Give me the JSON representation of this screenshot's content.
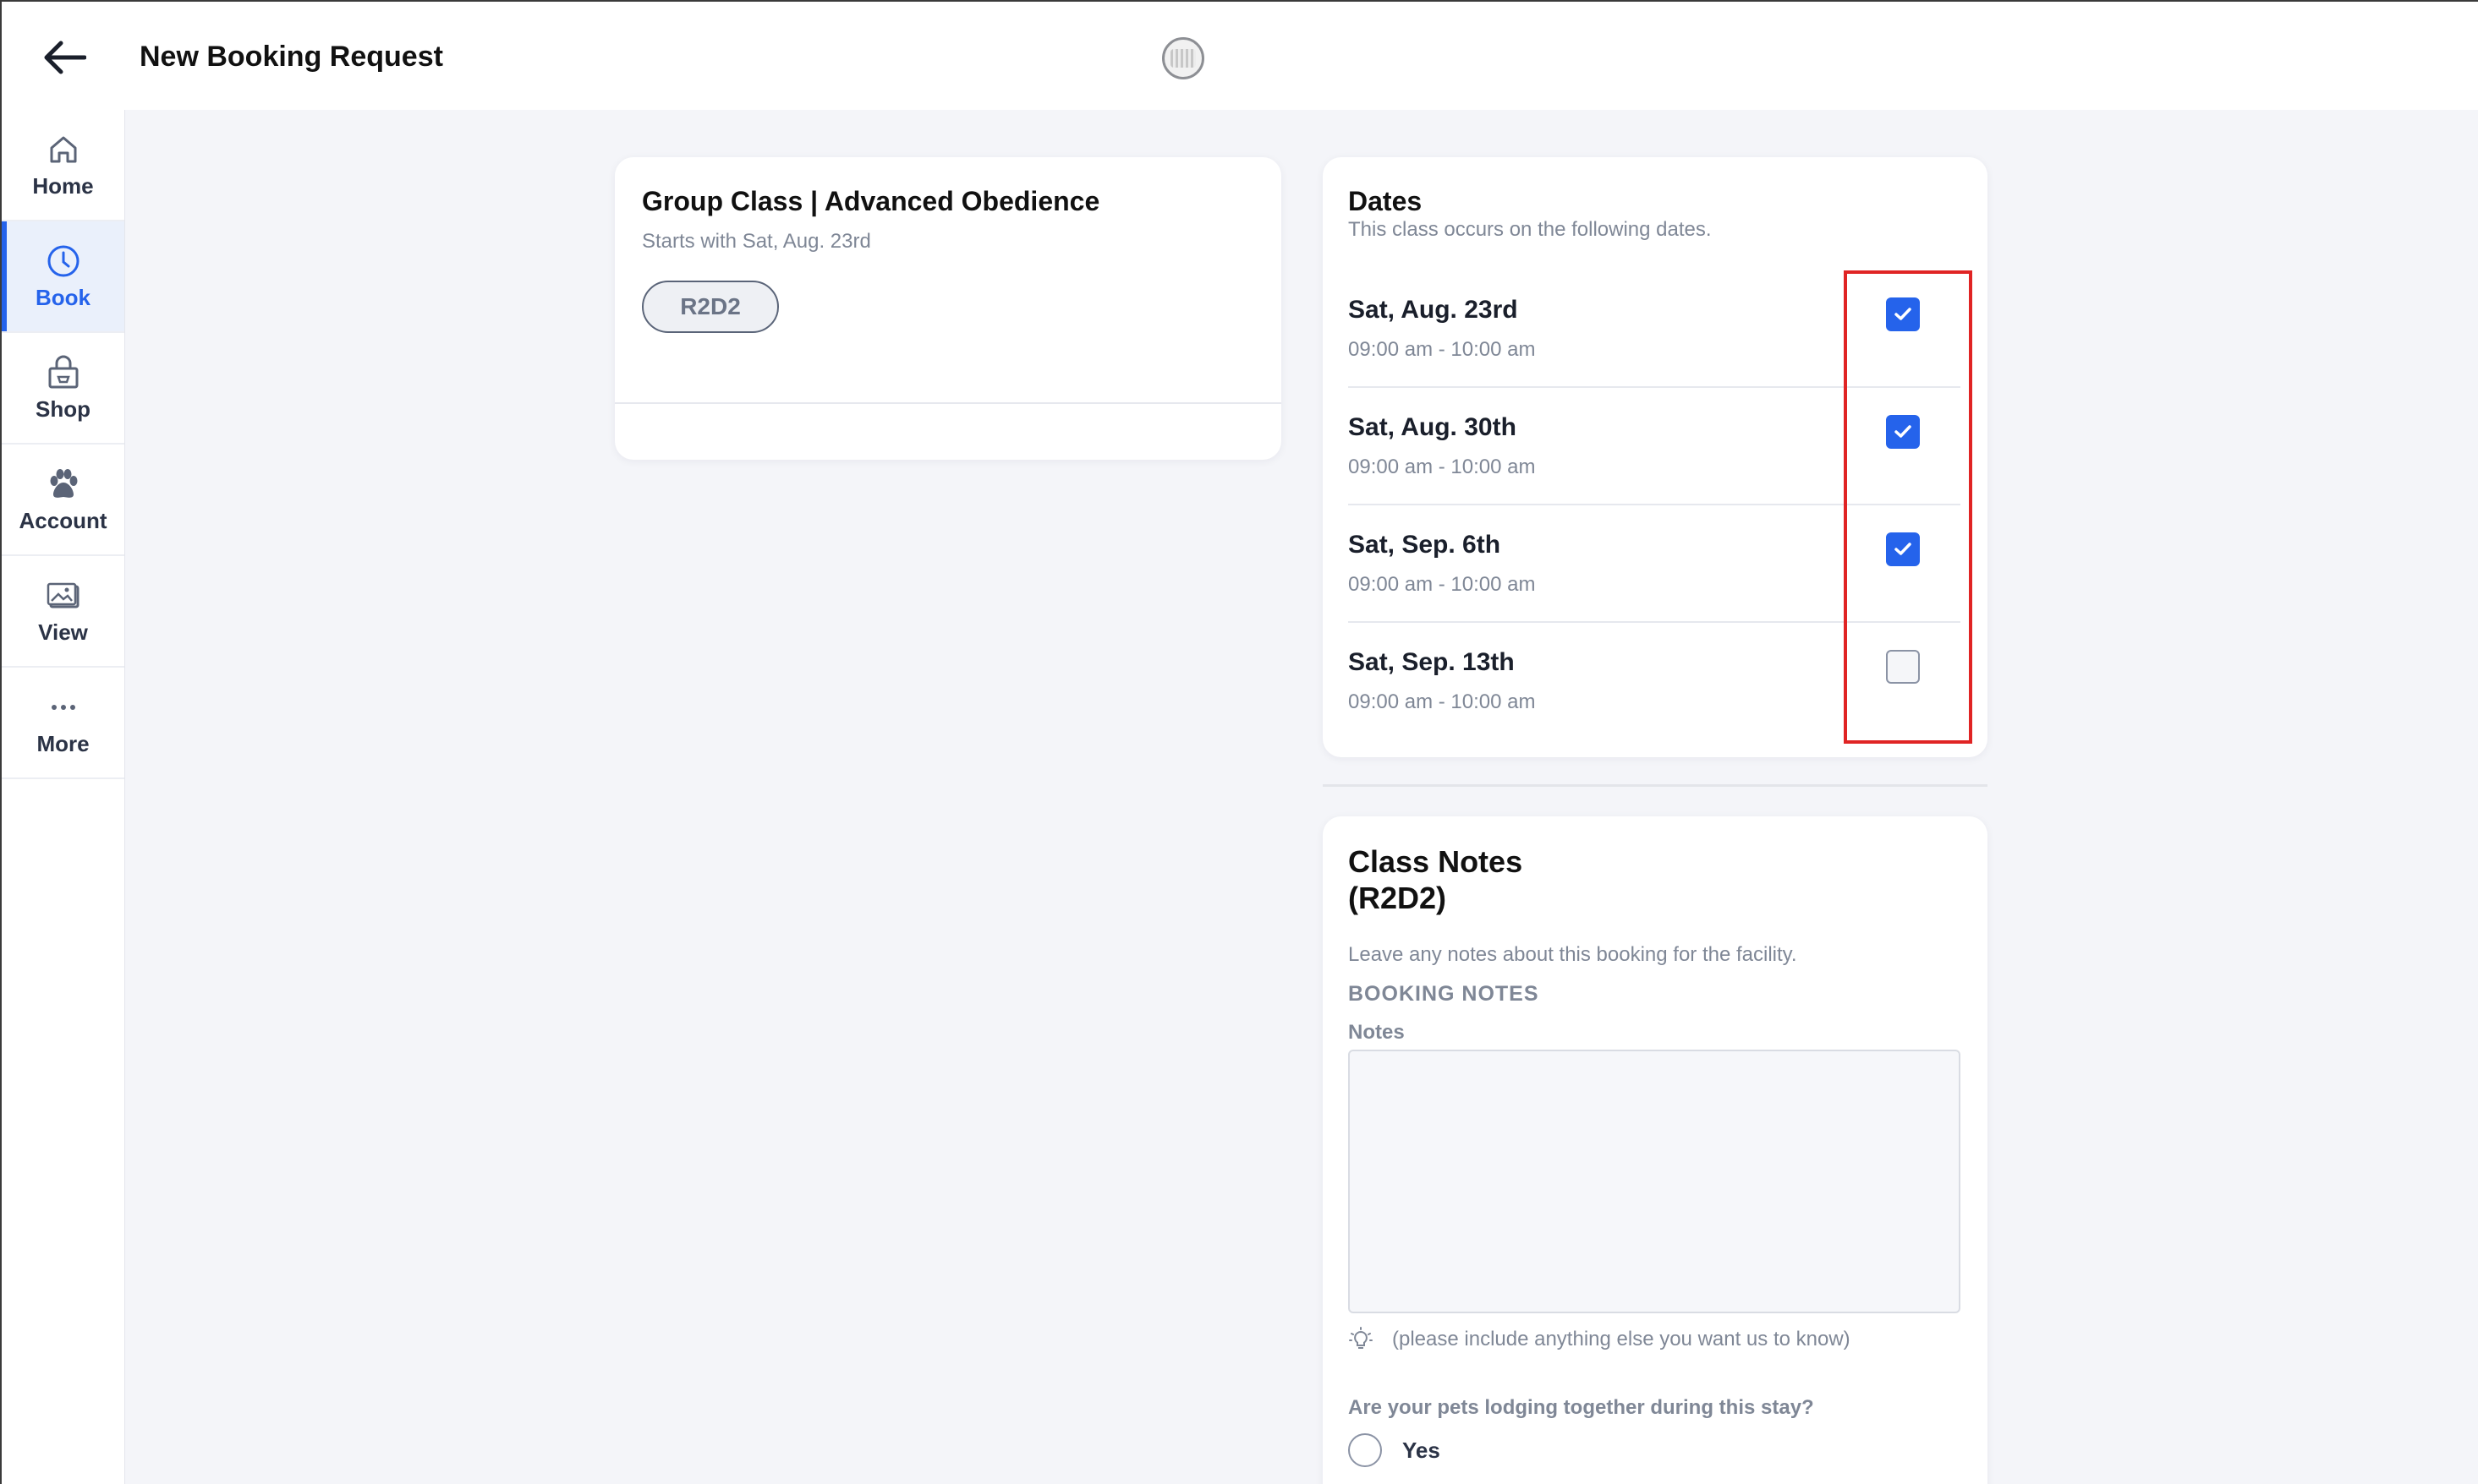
{
  "header": {
    "title": "New Booking Request",
    "back_icon": "arrow-left-icon",
    "logo_icon": "facility-logo-icon"
  },
  "sidebar": {
    "active": "Book",
    "accent_color": "#2563eb",
    "items": [
      {
        "label": "Home",
        "icon": "home-icon"
      },
      {
        "label": "Book",
        "icon": "clock-icon"
      },
      {
        "label": "Shop",
        "icon": "shop-bag-icon"
      },
      {
        "label": "Account",
        "icon": "paw-icon"
      },
      {
        "label": "View",
        "icon": "gallery-icon"
      },
      {
        "label": "More",
        "icon": "more-dots-icon"
      }
    ]
  },
  "class_card": {
    "title": "Group Class | Advanced Obedience",
    "subtitle": "Starts with Sat, Aug. 23rd",
    "pet_name": "R2D2"
  },
  "dates": {
    "title": "Dates",
    "subtitle": "This class occurs on the following dates.",
    "highlight_color": "#e02424",
    "items": [
      {
        "date": "Sat, Aug. 23rd",
        "time": "09:00 am - 10:00 am",
        "checked": true
      },
      {
        "date": "Sat, Aug. 30th",
        "time": "09:00 am - 10:00 am",
        "checked": true
      },
      {
        "date": "Sat, Sep. 6th",
        "time": "09:00 am - 10:00 am",
        "checked": true
      },
      {
        "date": "Sat, Sep. 13th",
        "time": "09:00 am - 10:00 am",
        "checked": false
      }
    ]
  },
  "notes": {
    "title_line1": "Class Notes",
    "title_line2": "(R2D2)",
    "description": "Leave any notes about this booking for the facility.",
    "section_heading": "BOOKING NOTES",
    "field_label": "Notes",
    "field_value": "",
    "hint": "(please include anything else you want us to know)",
    "hint_icon": "lightbulb-icon",
    "question": "Are your pets lodging together during this stay?",
    "option_yes": "Yes"
  }
}
